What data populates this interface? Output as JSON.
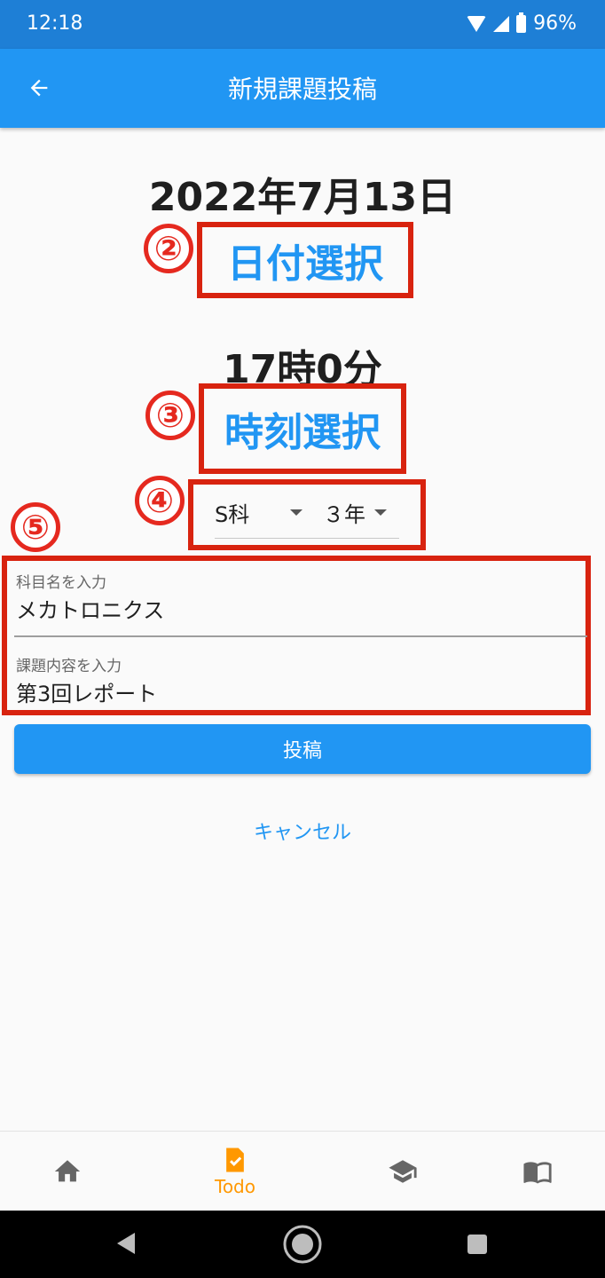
{
  "status_bar": {
    "time": "12:18",
    "battery": "96%"
  },
  "app_bar": {
    "title": "新規課題投稿",
    "back_icon": "arrow-back-icon"
  },
  "date": {
    "value": "2022年7月13日",
    "select_label": "日付選択"
  },
  "time": {
    "value": "17時0分",
    "select_label": "時刻選択"
  },
  "markers": [
    "②",
    "③",
    "④",
    "⑤"
  ],
  "selectors": {
    "department": "S科",
    "grade": "３年"
  },
  "fields": {
    "subject": {
      "label": "科目名を入力",
      "value": "メカトロニクス"
    },
    "content": {
      "label": "課題内容を入力",
      "value": "第3回レポート"
    }
  },
  "actions": {
    "submit": "投稿",
    "cancel": "キャンセル"
  },
  "bottom_nav": {
    "items": [
      {
        "icon": "home-icon"
      },
      {
        "icon": "todo-icon",
        "label": "Todo",
        "active": true
      },
      {
        "icon": "graduation-cap-icon"
      },
      {
        "icon": "book-icon"
      }
    ]
  },
  "colors": {
    "primary": "#2196f3",
    "status_bar": "#1e7fd6",
    "annotation": "#d8230f",
    "active_nav": "#ff9800"
  }
}
